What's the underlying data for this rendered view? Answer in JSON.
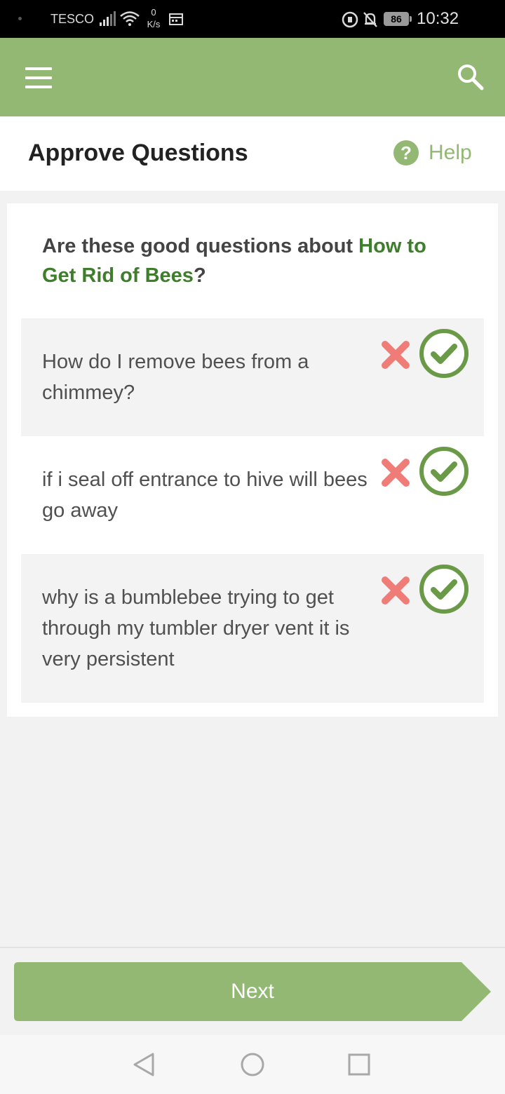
{
  "status_bar": {
    "carrier": "TESCO",
    "net_speed_value": "0",
    "net_speed_unit": "K/s",
    "battery": "86",
    "time": "10:32"
  },
  "app_bar": {
    "menu_icon": "hamburger-menu-icon",
    "search_icon": "search-icon",
    "color": "#93b874"
  },
  "header": {
    "title": "Approve Questions",
    "help_icon_glyph": "?",
    "help_label": "Help"
  },
  "prompt": {
    "prefix": "Are these good questions about ",
    "topic": "How to Get Rid of Bees",
    "suffix": "?"
  },
  "questions": [
    {
      "text": "How do I remove bees from a chimmey?"
    },
    {
      "text": "if i seal off entrance to hive will bees go away"
    },
    {
      "text": "why is a bumblebee trying to get through my tumbler dryer vent it is very persistent"
    }
  ],
  "colors": {
    "accent": "#93b874",
    "approve": "#6a9a47",
    "reject": "#f07c78",
    "topic": "#3e7d2b"
  },
  "footer": {
    "next_label": "Next"
  }
}
